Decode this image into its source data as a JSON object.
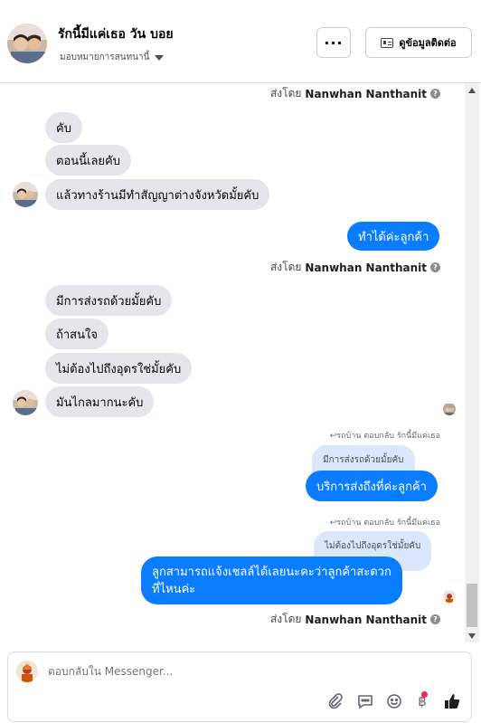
{
  "header": {
    "name": "รักนี้มีแค่เธอ วัน บอย",
    "assign_label": "มอบหมายการสนทนานี้",
    "more_label": "···",
    "contact_label": "ดูข้อมูลติดต่อ"
  },
  "messages": {
    "sent_by_prefix": "ส่งโดย",
    "sender_name": "Nanwhan Nanthanit",
    "in_1": "คับ",
    "in_2": "ตอนนี้เลยคับ",
    "in_3": "แล้วทางร้านมีทำสัญญาต่างจังหวัดมั้ยคับ",
    "out_1": "ทำได้ค่ะลูกค้า",
    "in_4": "มีการส่งรถด้วยมั้ยคับ",
    "in_5": "ถ้าสนใจ",
    "in_6": "ไม่ต้องไปถึงอุดรใช่มั้ยคับ",
    "in_7": "มันไกลมากนะคับ",
    "reply_meta_1": "รถบ้าน ตอบกลับ รักนี้มีแค่เธอ",
    "quoted_1": "มีการส่งรถด้วยมั้ยคับ",
    "out_2": "บริการส่งถึงที่ค่ะลูกค้า",
    "reply_meta_2": "รถบ้าน ตอบกลับ รักนี้มีแค่เธอ",
    "quoted_2": "ไม่ต้องไปถึงอุดรใช่มั้ยคับ",
    "out_3_line1": "ลูกสามารถแจ้งเชลล์ได้เลยนะคะว่าลูกค้าสะดวก",
    "out_3_line2": "ที่ไหนค่ะ"
  },
  "composer": {
    "placeholder": "ตอบกลับใน Messenger..."
  },
  "icons": {
    "attach": "paperclip-icon",
    "sticker": "chat-bubble-icon",
    "emoji": "smile-icon",
    "currency": "baht-icon",
    "like": "thumbs-up-icon"
  },
  "colors": {
    "accent": "#0a7cff",
    "incoming_bubble": "#e4e6eb",
    "quoted_bubble": "#dbe7fc",
    "notification": "#f02849"
  }
}
